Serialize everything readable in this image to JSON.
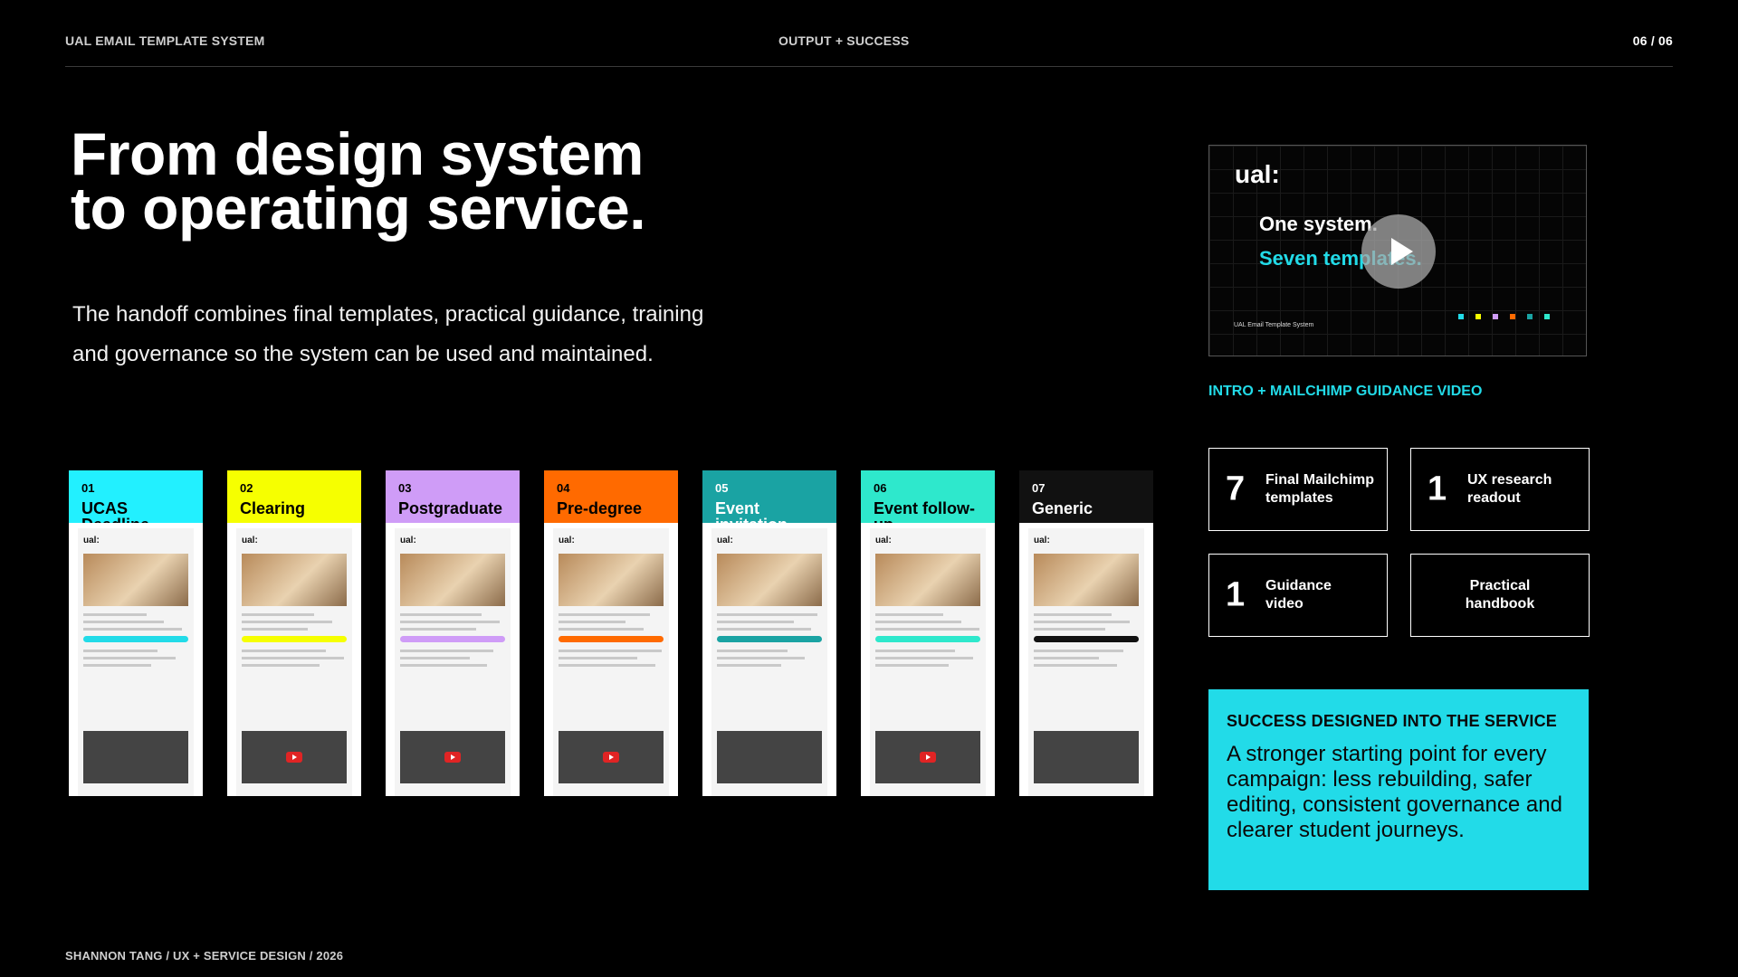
{
  "header": {
    "left": "UAL EMAIL TEMPLATE SYSTEM",
    "center": "OUTPUT + SUCCESS",
    "page": "06 / 06"
  },
  "title": {
    "line1": "From design system",
    "line2": "to operating service."
  },
  "subtitle": {
    "line1": "The handoff combines final templates, practical guidance, training",
    "line2": "and governance so the system can be used and maintained."
  },
  "templates": [
    {
      "num": "01",
      "name": "UCAS Deadline",
      "color": "#22f0ff",
      "text_color": "#000",
      "accent": "#22dbe8"
    },
    {
      "num": "02",
      "name": "Clearing",
      "color": "#f6ff00",
      "text_color": "#000",
      "accent": "#f6ff00"
    },
    {
      "num": "03",
      "name": "Postgraduate",
      "color": "#cf9cf7",
      "text_color": "#000",
      "accent": "#cf9cf7"
    },
    {
      "num": "04",
      "name": "Pre-degree",
      "color": "#ff6a00",
      "text_color": "#000",
      "accent": "#ff6a00"
    },
    {
      "num": "05",
      "name": "Event invitation",
      "color": "#1aa3a3",
      "text_color": "#fff",
      "accent": "#1aa3a3"
    },
    {
      "num": "06",
      "name": "Event follow-up",
      "color": "#2ee8cc",
      "text_color": "#000",
      "accent": "#2ee8cc"
    },
    {
      "num": "07",
      "name": "Generic",
      "color": "#111111",
      "text_color": "#fff",
      "accent": "#111111"
    }
  ],
  "template_logo": "ual:",
  "video": {
    "logo": "ual:",
    "line1": "One system.",
    "line2": "Seven templates.",
    "caption": "UAL Email Template System",
    "label": "INTRO + MAILCHIMP GUIDANCE VIDEO",
    "dot_colors": [
      "#22dbe8",
      "#f6ff00",
      "#cf9cf7",
      "#ff6a00",
      "#1aa3a3",
      "#2ee8cc"
    ]
  },
  "stats": [
    {
      "value": "7",
      "label": "Final Mailchimp templates"
    },
    {
      "value": "1",
      "label": "UX research readout"
    },
    {
      "value": "1",
      "label": "Guidance video"
    },
    {
      "value": "",
      "label": "Practical handbook"
    }
  ],
  "success": {
    "heading": "SUCCESS DESIGNED INTO THE SERVICE",
    "body": "A stronger starting point for every campaign: less rebuilding, safer editing, consistent governance and clearer student journeys."
  },
  "footer": "SHANNON TANG  /  UX + SERVICE DESIGN  /  2026",
  "colors": {
    "accent": "#22dbe8",
    "background": "#000000"
  }
}
